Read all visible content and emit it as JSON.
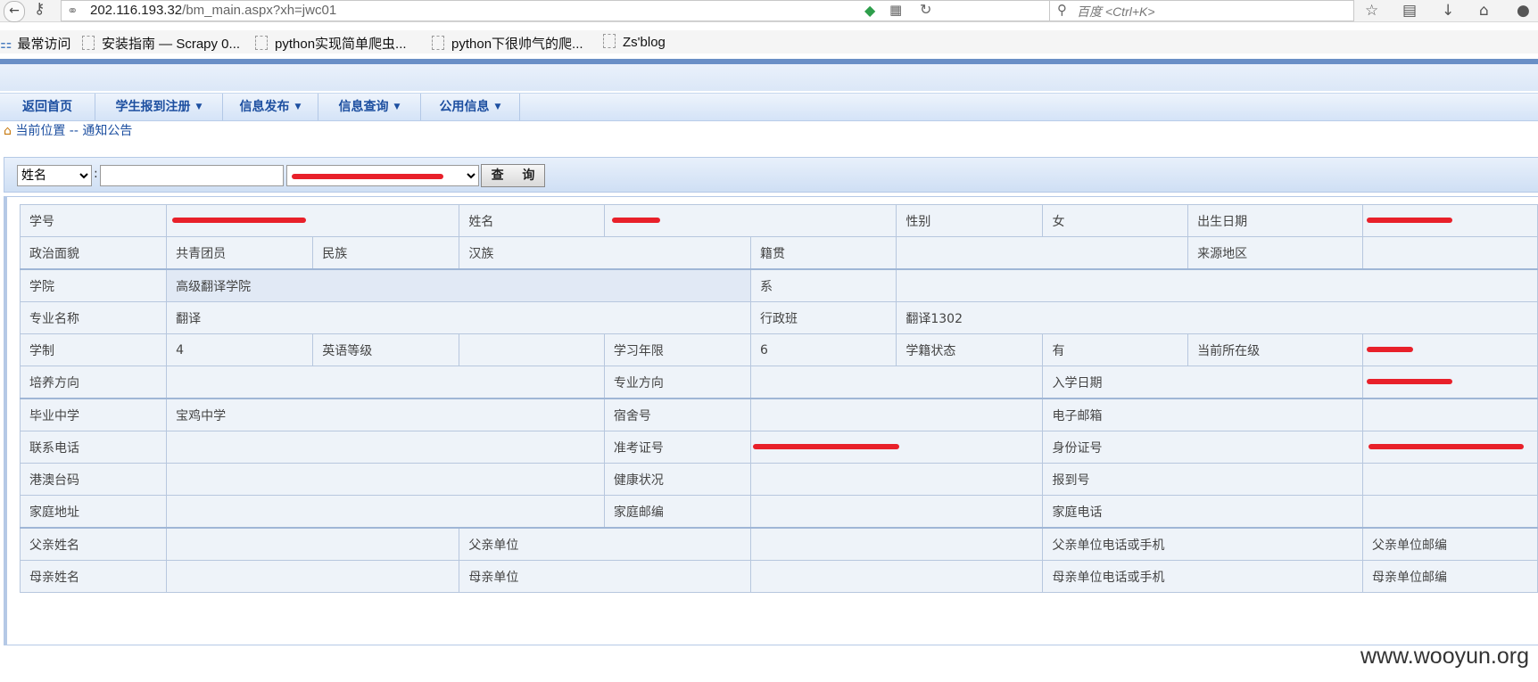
{
  "browser": {
    "url_host": "202.116.193.32",
    "url_path": "/bm_main.aspx?xh=jwc01",
    "search_placeholder": "百度 <Ctrl+K>",
    "bookmarks": [
      "最常访问",
      "安装指南 — Scrapy 0...",
      "python实现简单爬虫...",
      "python下很帅气的爬...",
      "Zs'blog"
    ]
  },
  "menu": [
    "返回首页",
    "学生报到注册",
    "信息发布",
    "信息查询",
    "公用信息"
  ],
  "breadcrumb": {
    "label": "当前位置",
    "sep": "--",
    "page": "通知公告"
  },
  "search": {
    "field": "姓名",
    "colon": ":",
    "input_value": "",
    "select_value": "",
    "button": "查  询"
  },
  "table": {
    "r1": [
      "学号",
      "",
      "姓名",
      "",
      "性别",
      "女",
      "出生日期",
      ""
    ],
    "r2": [
      "政治面貌",
      "共青团员",
      "民族",
      "汉族",
      "籍贯",
      "",
      "来源地区",
      ""
    ],
    "r3": [
      "学院",
      "高级翻译学院",
      "系",
      ""
    ],
    "r4": [
      "专业名称",
      "翻译",
      "行政班",
      "翻译1302"
    ],
    "r5": [
      "学制",
      "4",
      "英语等级",
      "",
      "学习年限",
      "6",
      "学籍状态",
      "有",
      "当前所在级",
      ""
    ],
    "r6": [
      "培养方向",
      "",
      "专业方向",
      "",
      "入学日期",
      ""
    ],
    "r7": [
      "毕业中学",
      "宝鸡中学",
      "宿舍号",
      "",
      "电子邮箱",
      ""
    ],
    "r8": [
      "联系电话",
      "",
      "准考证号",
      "",
      "身份证号",
      ""
    ],
    "r9": [
      "港澳台码",
      "",
      "健康状况",
      "",
      "报到号",
      ""
    ],
    "r10": [
      "家庭地址",
      "",
      "家庭邮编",
      "",
      "家庭电话",
      ""
    ],
    "r11": [
      "父亲姓名",
      "",
      "父亲单位",
      "",
      "父亲单位电话或手机",
      "",
      "父亲单位邮编"
    ],
    "r12": [
      "母亲姓名",
      "",
      "母亲单位",
      "",
      "母亲单位电话或手机",
      "",
      "母亲单位邮编"
    ]
  },
  "watermark": "www.wooyun.org",
  "colors": {
    "menu_text": "#1d4fa0",
    "cell_bg": "#eef3f9",
    "border": "#b7c7de",
    "redaction": "#e8202a"
  }
}
